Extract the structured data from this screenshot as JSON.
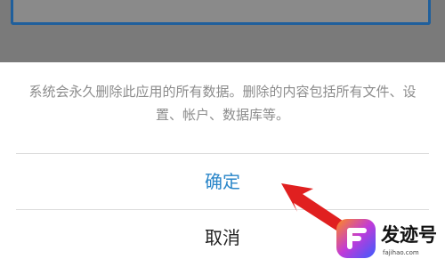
{
  "dialog": {
    "message": "系统会永久删除此应用的所有数据。删除的内容包括所有文件、设置、帐户、数据库等。",
    "confirm_label": "确定",
    "cancel_label": "取消"
  },
  "watermark": {
    "brand": "发迹号",
    "site": "fajihao.com"
  },
  "colors": {
    "confirm": "#2a86c9",
    "arrow": "#e02020"
  }
}
